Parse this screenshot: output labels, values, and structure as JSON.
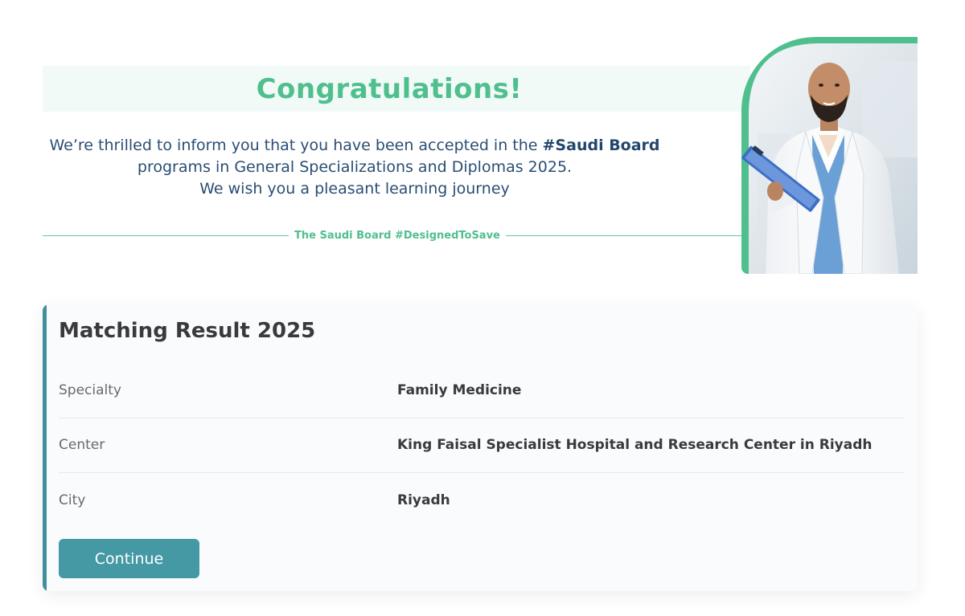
{
  "banner": {
    "title": "Congratulations!",
    "message_line1_prefix": "We’re thrilled to inform you that you have been accepted in the ",
    "message_line1_highlight": "#Saudi Board",
    "message_line2": "programs in General Specializations and Diplomas 2025.",
    "message_line3": "We wish you a pleasant learning journey",
    "tagline": "The Saudi Board #DesignedToSave"
  },
  "result": {
    "title": "Matching Result 2025",
    "rows": [
      {
        "label": "Specialty",
        "value": "Family Medicine"
      },
      {
        "label": "Center",
        "value": "King Faisal Specialist Hospital and Research Center in Riyadh"
      },
      {
        "label": "City",
        "value": "Riyadh"
      }
    ],
    "continue_label": "Continue"
  },
  "colors": {
    "brand_green": "#4fbf8e",
    "navy_text": "#2a4d74",
    "accent_teal": "#3f8f9d",
    "button_teal": "#4499a4"
  }
}
